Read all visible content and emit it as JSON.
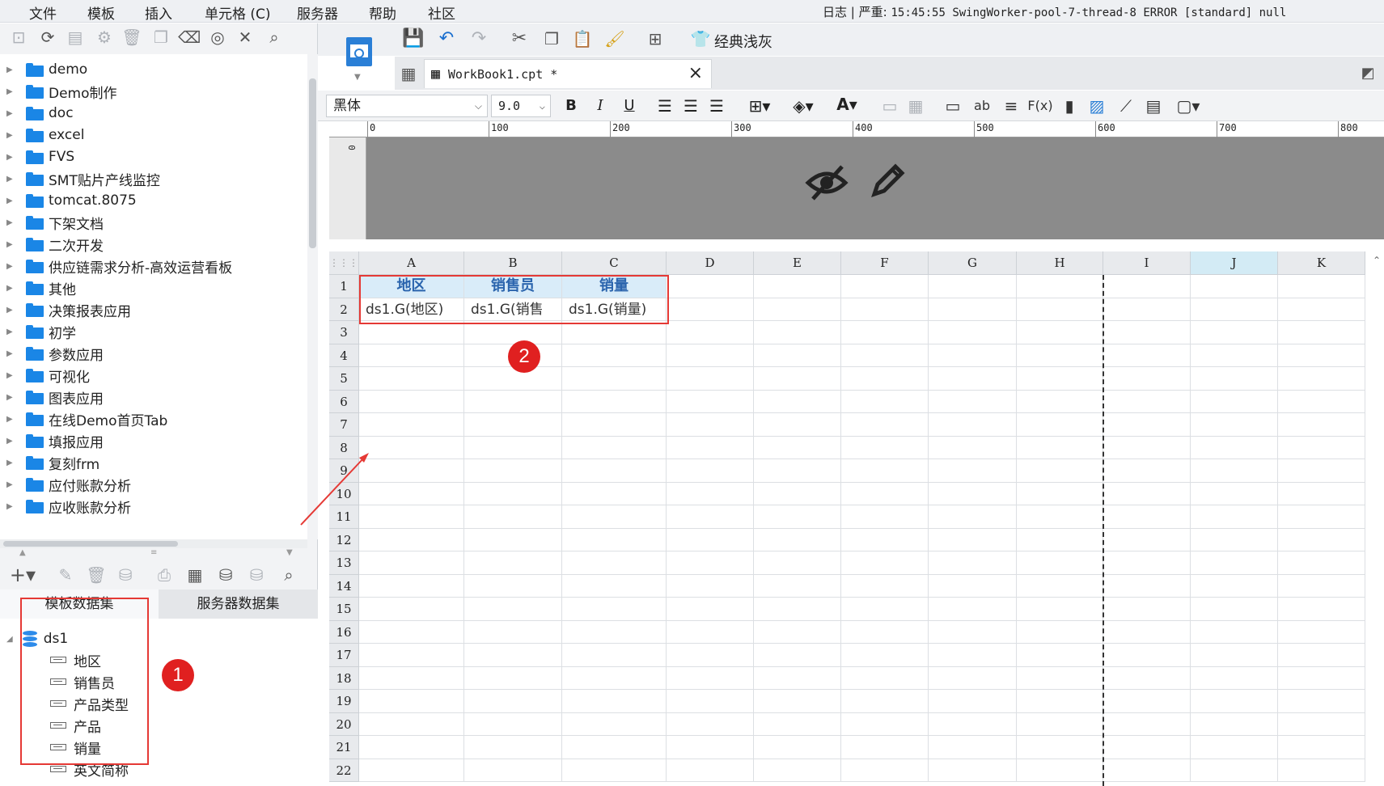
{
  "menu": [
    "文件",
    "模板",
    "插入",
    "单元格 (C)",
    "服务器",
    "帮助",
    "社区"
  ],
  "log": {
    "label": "日志",
    "severity": "严重:",
    "message": "15:45:55 SwingWorker-pool-7-thread-8 ERROR [standard] null"
  },
  "left_toolbar_icons": [
    "new-folder-icon",
    "refresh-icon",
    "template-icon",
    "settings-icon",
    "delete-icon",
    "copy-icon",
    "clear-icon",
    "locate-icon",
    "collapse-icon",
    "search-icon"
  ],
  "tree": {
    "items": [
      "demo",
      "Demo制作",
      "doc",
      "excel",
      "FVS",
      "SMT贴片产线监控",
      "tomcat.8075",
      "下架文档",
      "二次开发",
      "供应链需求分析-高效运营看板",
      "其他",
      "决策报表应用",
      "初学",
      "参数应用",
      "可视化",
      "图表应用",
      "在线Demo首页Tab",
      "填报应用",
      "复刻frm",
      "应付账款分析",
      "应收账款分析"
    ]
  },
  "dataset_tabs": {
    "template": "模板数据集",
    "server": "服务器数据集"
  },
  "dataset": {
    "name": "ds1",
    "fields": [
      "地区",
      "销售员",
      "产品类型",
      "产品",
      "销量",
      "英文简称"
    ]
  },
  "toolbar": {
    "theme_label": "经典浅灰"
  },
  "file_tab": {
    "name": "WorkBook1.cpt *",
    "close": "×"
  },
  "format": {
    "font": "黑体",
    "size": "9.0",
    "bold": "B",
    "italic": "I",
    "underline": "U",
    "ab": "ab",
    "fx": "F(x)"
  },
  "ruler": [
    "0",
    "100",
    "200",
    "300",
    "400",
    "500",
    "600",
    "700",
    "800"
  ],
  "v_ruler": "0",
  "columns": [
    "A",
    "B",
    "C",
    "D",
    "E",
    "F",
    "G",
    "H",
    "I",
    "J",
    "K"
  ],
  "selected_column": "J",
  "rows": [
    "1",
    "2",
    "3",
    "4",
    "5",
    "6",
    "7",
    "8",
    "9",
    "10",
    "11",
    "12",
    "13",
    "14",
    "15",
    "16",
    "17",
    "18",
    "19",
    "20",
    "21",
    "22"
  ],
  "cells": {
    "row1": [
      "地区",
      "销售员",
      "销量"
    ],
    "row2": [
      "ds1.G(地区)",
      "ds1.G(销售",
      "ds1.G(销量)"
    ]
  },
  "badges": [
    "1",
    "2"
  ],
  "colors": {
    "accent": "#1a86e6",
    "highlight": "#e53935",
    "badge": "#e02020",
    "header_cell": "#d9ecf9"
  }
}
